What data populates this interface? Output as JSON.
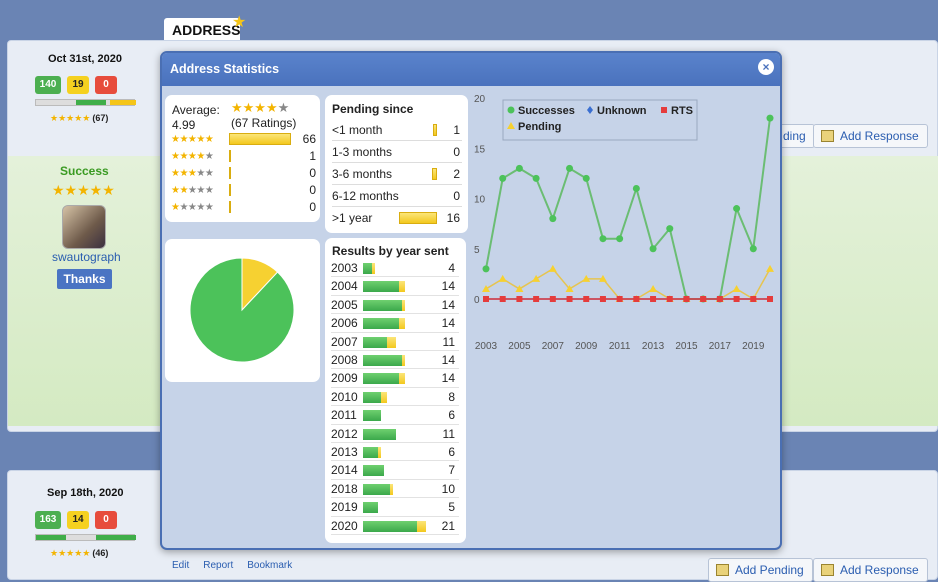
{
  "page": {
    "address_tab": "ADDRESS",
    "entries": [
      {
        "date": "Oct 31st, 2020",
        "badges": [
          "140",
          "19",
          "0"
        ],
        "stars_count": "(67)",
        "status": "Success",
        "username": "swautograph",
        "thanks_label": "Thanks",
        "pending_partial": "ding",
        "add_response": "Add Response"
      },
      {
        "date": "Sep 18th, 2020",
        "badges": [
          "163",
          "14",
          "0"
        ],
        "stars_count": "(46)",
        "add_pending": "Add Pending",
        "add_response": "Add Response"
      }
    ],
    "footer_links": [
      "Edit",
      "Report",
      "Bookmark"
    ]
  },
  "modal": {
    "title": "Address Statistics",
    "close_glyph": "×",
    "ratings": {
      "average_label": "Average:",
      "average_value": "4.99",
      "ratings_count": "(67 Ratings)",
      "rows": [
        {
          "stars": 5,
          "count": "66",
          "fraction": 1.0
        },
        {
          "stars": 4,
          "count": "1",
          "fraction": 0.015
        },
        {
          "stars": 3,
          "count": "0",
          "fraction": 0
        },
        {
          "stars": 2,
          "count": "0",
          "fraction": 0
        },
        {
          "stars": 1,
          "count": "0",
          "fraction": 0
        }
      ]
    },
    "pie": {
      "success_fraction": 0.88,
      "pending_fraction": 0.12,
      "colors": {
        "success": "#4cc25a",
        "pending": "#f6d131"
      }
    },
    "pending": {
      "title": "Pending since",
      "rows": [
        {
          "label": "<1 month",
          "value": "1",
          "fraction": 0.06
        },
        {
          "label": "1-3 months",
          "value": "0",
          "fraction": 0
        },
        {
          "label": "3-6 months",
          "value": "2",
          "fraction": 0.12
        },
        {
          "label": "6-12 months",
          "value": "0",
          "fraction": 0
        },
        {
          "label": ">1 year",
          "value": "16",
          "fraction": 1.0
        }
      ]
    },
    "years": {
      "title": "Results by year sent",
      "rows": [
        {
          "year": "2003",
          "value": "4",
          "success": 3,
          "pending": 1
        },
        {
          "year": "2004",
          "value": "14",
          "success": 12,
          "pending": 2
        },
        {
          "year": "2005",
          "value": "14",
          "success": 13,
          "pending": 1
        },
        {
          "year": "2006",
          "value": "14",
          "success": 12,
          "pending": 2
        },
        {
          "year": "2007",
          "value": "11",
          "success": 8,
          "pending": 3
        },
        {
          "year": "2008",
          "value": "14",
          "success": 13,
          "pending": 1
        },
        {
          "year": "2009",
          "value": "14",
          "success": 12,
          "pending": 2
        },
        {
          "year": "2010",
          "value": "8",
          "success": 6,
          "pending": 2
        },
        {
          "year": "2011",
          "value": "6",
          "success": 6,
          "pending": 0
        },
        {
          "year": "2012",
          "value": "11",
          "success": 11,
          "pending": 0
        },
        {
          "year": "2013",
          "value": "6",
          "success": 5,
          "pending": 1
        },
        {
          "year": "2014",
          "value": "7",
          "success": 7,
          "pending": 0
        },
        {
          "year": "2018",
          "value": "10",
          "success": 9,
          "pending": 1
        },
        {
          "year": "2019",
          "value": "5",
          "success": 5,
          "pending": 0
        },
        {
          "year": "2020",
          "value": "21",
          "success": 18,
          "pending": 3
        }
      ]
    }
  },
  "chart_data": {
    "type": "line",
    "x": [
      2003,
      2004,
      2005,
      2006,
      2007,
      2008,
      2009,
      2010,
      2011,
      2012,
      2013,
      2014,
      2015,
      2016,
      2017,
      2018,
      2019,
      2020
    ],
    "x_tick_labels": [
      "2003",
      "2005",
      "2007",
      "2009",
      "2011",
      "2013",
      "2015",
      "2017",
      "2019"
    ],
    "ylim": [
      0,
      20
    ],
    "y_ticks": [
      "0",
      "5",
      "10",
      "15",
      "20"
    ],
    "legend_position": "top-left",
    "series": [
      {
        "name": "Successes",
        "color": "#4cc25a",
        "marker": "circle",
        "values": [
          3,
          12,
          13,
          12,
          8,
          13,
          12,
          6,
          6,
          11,
          5,
          7,
          0,
          0,
          0,
          9,
          5,
          18
        ]
      },
      {
        "name": "Unknown",
        "color": "#3a6fd1",
        "marker": "diamond",
        "values": [
          0,
          0,
          0,
          0,
          0,
          0,
          0,
          0,
          0,
          0,
          0,
          0,
          0,
          0,
          0,
          0,
          0,
          0
        ]
      },
      {
        "name": "RTS",
        "color": "#e53c3c",
        "marker": "square",
        "values": [
          0,
          0,
          0,
          0,
          0,
          0,
          0,
          0,
          0,
          0,
          0,
          0,
          0,
          0,
          0,
          0,
          0,
          0
        ]
      },
      {
        "name": "Pending",
        "color": "#f6d131",
        "marker": "triangle",
        "values": [
          1,
          2,
          1,
          2,
          3,
          1,
          2,
          2,
          0,
          0,
          1,
          0,
          0,
          0,
          0,
          1,
          0,
          3
        ]
      }
    ]
  }
}
